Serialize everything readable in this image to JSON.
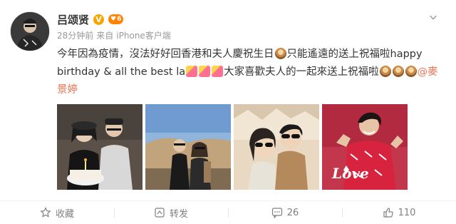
{
  "post": {
    "username": "吕颂贤",
    "verified_mark": "V",
    "vip_level": "6",
    "time": "28分钟前",
    "source_prefix": "来自",
    "source": "iPhone客户端",
    "text_part1": "今年因為疫情，沒法好好回香港和夫人慶祝生日",
    "text_part2": "只能遙遠的送上祝福啦happy birthday & all the best la",
    "text_part3": "大家喜歡夫人的一起來送上祝福啦",
    "mention": "@麥景婷",
    "photo_overlay_text": "Love"
  },
  "actions": {
    "favorite_label": "收藏",
    "repost_label": "转发",
    "comment_count": "26",
    "like_count": "110"
  },
  "colors": {
    "verified": "#f7a600",
    "vip": "#ff8200",
    "mention": "#eb7350",
    "meta": "#999999"
  }
}
